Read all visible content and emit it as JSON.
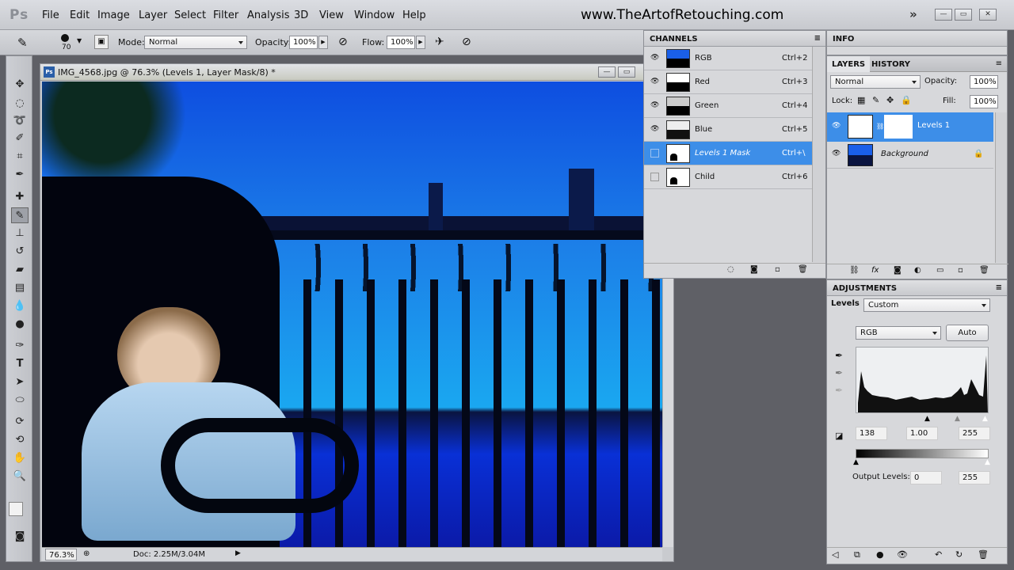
{
  "app": {
    "logo": "Ps",
    "website": "www.TheArtofRetouching.com"
  },
  "menu": [
    "File",
    "Edit",
    "Image",
    "Layer",
    "Select",
    "Filter",
    "Analysis",
    "3D",
    "View",
    "Window",
    "Help"
  ],
  "options": {
    "brush_size": "70",
    "mode_label": "Mode:",
    "mode_value": "Normal",
    "opacity_label": "Opacity:",
    "opacity_value": "100%",
    "flow_label": "Flow:",
    "flow_value": "100%"
  },
  "document": {
    "title": "IMG_4568.jpg @ 76.3% (Levels 1, Layer Mask/8) *",
    "zoom": "76.3%",
    "doc_size": "Doc: 2.25M/3.04M"
  },
  "channels": {
    "title": "CHANNELS",
    "items": [
      {
        "name": "RGB",
        "shortcut": "Ctrl+2",
        "visible": true
      },
      {
        "name": "Red",
        "shortcut": "Ctrl+3",
        "visible": true
      },
      {
        "name": "Green",
        "shortcut": "Ctrl+4",
        "visible": true
      },
      {
        "name": "Blue",
        "shortcut": "Ctrl+5",
        "visible": true
      },
      {
        "name": "Levels 1 Mask",
        "shortcut": "Ctrl+\\",
        "visible": false,
        "selected": true
      },
      {
        "name": "Child",
        "shortcut": "Ctrl+6",
        "visible": false
      }
    ]
  },
  "info": {
    "title": "INFO"
  },
  "layers": {
    "tab1": "LAYERS",
    "tab2": "HISTORY",
    "blend": "Normal",
    "opacity_label": "Opacity:",
    "opacity": "100%",
    "lock_label": "Lock:",
    "fill_label": "Fill:",
    "fill": "100%",
    "items": [
      {
        "name": "Levels 1",
        "selected": true
      },
      {
        "name": "Background",
        "locked": true
      }
    ]
  },
  "adjustments": {
    "title": "ADJUSTMENTS",
    "type_label": "Levels",
    "preset": "Custom",
    "channel": "RGB",
    "auto_label": "Auto",
    "input_black": "138",
    "input_gamma": "1.00",
    "input_white": "255",
    "output_label": "Output Levels:",
    "output_black": "0",
    "output_white": "255"
  }
}
